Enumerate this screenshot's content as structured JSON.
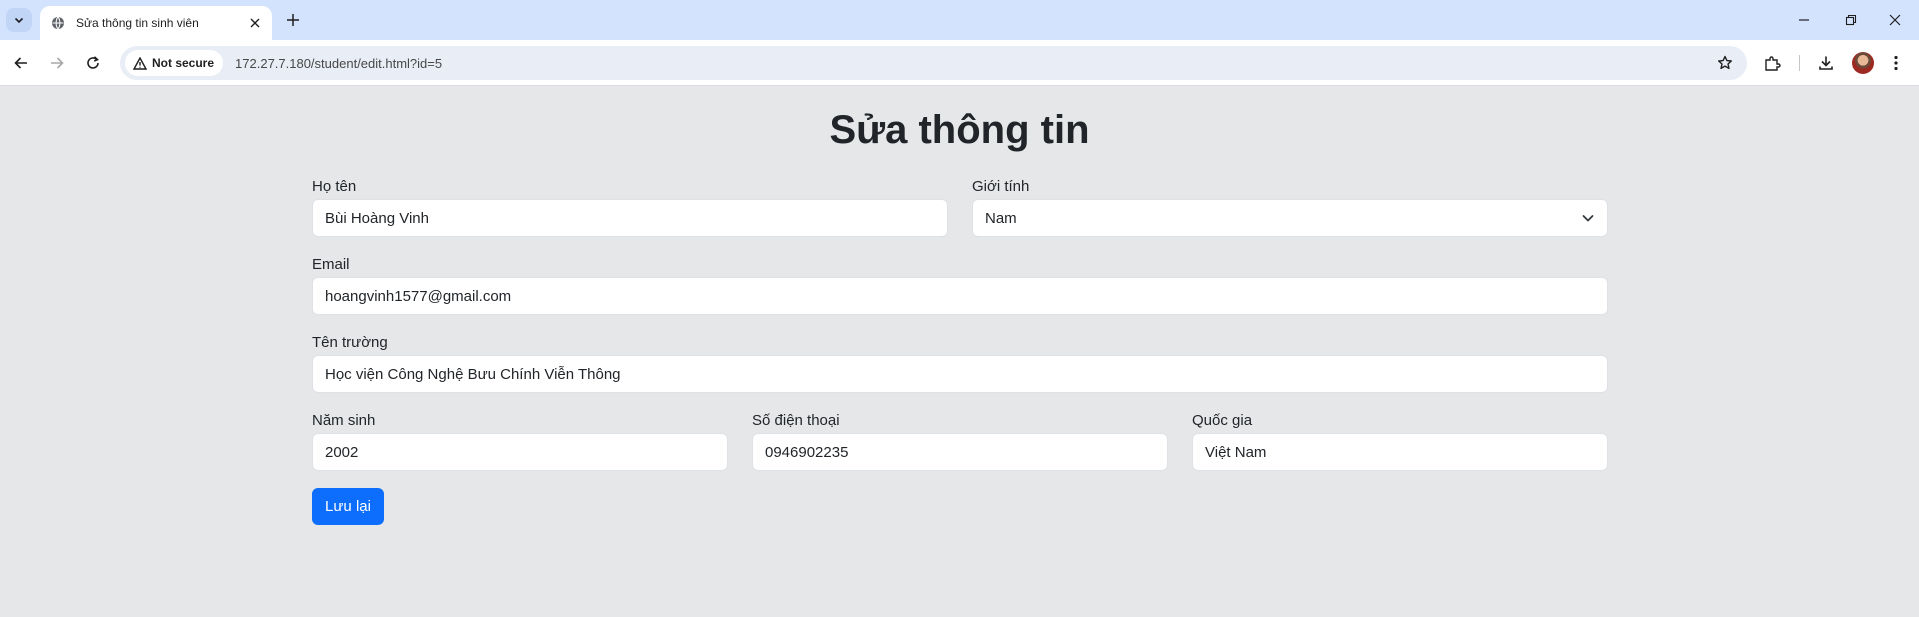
{
  "browser": {
    "tab_title": "Sửa thông tin sinh viên",
    "security_label": "Not secure",
    "url": "172.27.7.180/student/edit.html?id=5",
    "icons": [
      "tab-search-icon",
      "globe-icon",
      "close-icon",
      "plus-icon",
      "minimize-icon",
      "restore-icon",
      "back-icon",
      "forward-icon",
      "reload-icon",
      "warning-icon",
      "star-icon",
      "extensions-icon",
      "download-icon",
      "menu-icon"
    ]
  },
  "page": {
    "title": "Sửa thông tin",
    "fields": {
      "name": {
        "label": "Họ tên",
        "value": "Bùi Hoàng Vinh"
      },
      "gender": {
        "label": "Giới tính",
        "value": "Nam"
      },
      "email": {
        "label": "Email",
        "value": "hoangvinh1577@gmail.com"
      },
      "school": {
        "label": "Tên trường",
        "value": "Học viện Công Nghệ Bưu Chính Viễn Thông"
      },
      "birth_year": {
        "label": "Năm sinh",
        "value": "2002"
      },
      "phone": {
        "label": "Số điện thoại",
        "value": "0946902235"
      },
      "country": {
        "label": "Quốc gia",
        "value": "Việt Nam"
      }
    },
    "save_label": "Lưu lại",
    "colors": {
      "primary": "#0d6efd",
      "background": "#e6e7e9"
    }
  }
}
